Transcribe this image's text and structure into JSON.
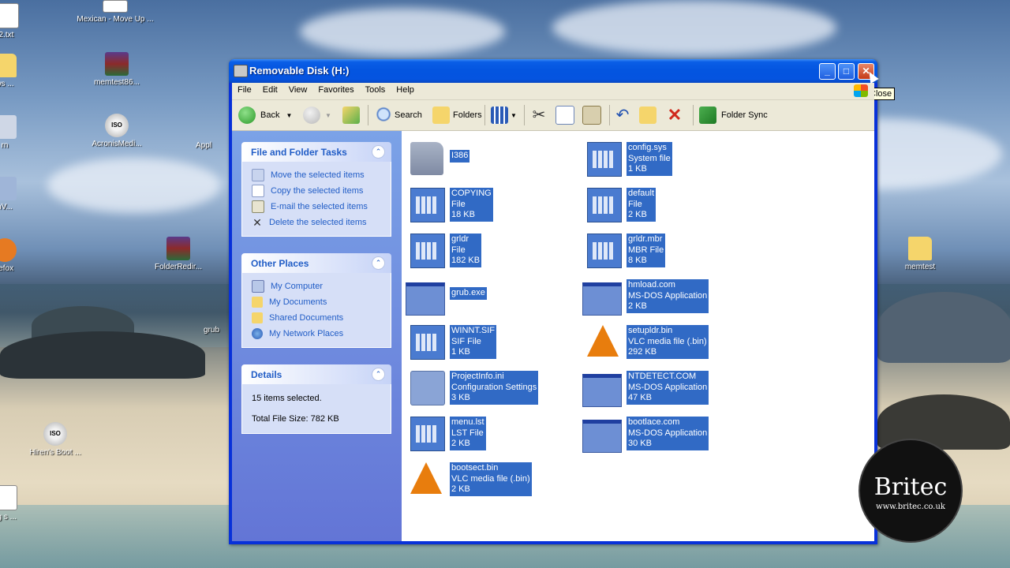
{
  "desktop": {
    "icons": [
      {
        "label": "2.txt",
        "kind": "txt"
      },
      {
        "label": "Mexican - Move Up ...",
        "kind": "doc"
      },
      {
        "label": "ws ...",
        "kind": "folder"
      },
      {
        "label": "memtest86...",
        "kind": "rar"
      },
      {
        "label": "rn",
        "kind": "app"
      },
      {
        "label": "AcronisMedi...",
        "kind": "iso"
      },
      {
        "label": "Appl",
        "kind": "app"
      },
      {
        "label": "nV...",
        "kind": "app"
      },
      {
        "label": "refox",
        "kind": "app"
      },
      {
        "label": "FolderRedir...",
        "kind": "rar"
      },
      {
        "label": "memtest",
        "kind": "folder"
      },
      {
        "label": "grub",
        "kind": "app"
      },
      {
        "label": "Hiren's Boot ...",
        "kind": "iso"
      },
      {
        "label": "ng s ...",
        "kind": "app"
      }
    ],
    "iso_badge": "ISO"
  },
  "window": {
    "title": "Removable Disk (H:)",
    "controls": {
      "minimize": "_",
      "maximize": "□",
      "close": "✕"
    },
    "tooltip": "Close"
  },
  "menu": [
    "File",
    "Edit",
    "View",
    "Favorites",
    "Tools",
    "Help"
  ],
  "toolbar": {
    "back": "Back",
    "search": "Search",
    "folders": "Folders",
    "folder_sync": "Folder Sync"
  },
  "left_pane": {
    "tasks": {
      "title": "File and Folder Tasks",
      "chevron": "⌃",
      "items": [
        {
          "label": "Move the selected items",
          "icon": "move-icon"
        },
        {
          "label": "Copy the selected items",
          "icon": "copy-icon"
        },
        {
          "label": "E-mail the selected items",
          "icon": "email-icon"
        },
        {
          "label": "Delete the selected items",
          "icon": "delete-icon"
        }
      ]
    },
    "other_places": {
      "title": "Other Places",
      "chevron": "⌃",
      "items": [
        {
          "label": "My Computer",
          "icon": "computer-icon"
        },
        {
          "label": "My Documents",
          "icon": "documents-icon"
        },
        {
          "label": "Shared Documents",
          "icon": "shared-folder-icon"
        },
        {
          "label": "My Network Places",
          "icon": "network-icon"
        }
      ]
    },
    "details": {
      "title": "Details",
      "chevron": "⌃",
      "selected": "15 items selected.",
      "total_size": "Total File Size: 782 KB"
    }
  },
  "files": [
    {
      "name": "I386",
      "type": "",
      "size": "",
      "icon": "folder"
    },
    {
      "name": "config.sys",
      "type": "System file",
      "size": "1 KB",
      "icon": "doc"
    },
    {
      "name": "COPYING",
      "type": "File",
      "size": "18 KB",
      "icon": "doc"
    },
    {
      "name": "default",
      "type": "File",
      "size": "2 KB",
      "icon": "doc"
    },
    {
      "name": "grldr",
      "type": "File",
      "size": "182 KB",
      "icon": "doc"
    },
    {
      "name": "grldr.mbr",
      "type": "MBR File",
      "size": "8 KB",
      "icon": "doc"
    },
    {
      "name": "grub.exe",
      "type": "",
      "size": "",
      "icon": "app"
    },
    {
      "name": "hmload.com",
      "type": "MS-DOS Application",
      "size": "2 KB",
      "icon": "app"
    },
    {
      "name": "WINNT.SIF",
      "type": "SIF File",
      "size": "1 KB",
      "icon": "doc"
    },
    {
      "name": "setupldr.bin",
      "type": "VLC media file (.bin)",
      "size": "292 KB",
      "icon": "vlc"
    },
    {
      "name": "ProjectInfo.ini",
      "type": "Configuration Settings",
      "size": "3 KB",
      "icon": "ini"
    },
    {
      "name": "NTDETECT.COM",
      "type": "MS-DOS Application",
      "size": "47 KB",
      "icon": "app"
    },
    {
      "name": "menu.lst",
      "type": "LST File",
      "size": "2 KB",
      "icon": "doc"
    },
    {
      "name": "bootlace.com",
      "type": "MS-DOS Application",
      "size": "30 KB",
      "icon": "app"
    },
    {
      "name": "bootsect.bin",
      "type": "VLC media file (.bin)",
      "size": "2 KB",
      "icon": "vlc"
    }
  ],
  "watermark": {
    "brand": "Britec",
    "url": "www.britec.co.uk"
  }
}
